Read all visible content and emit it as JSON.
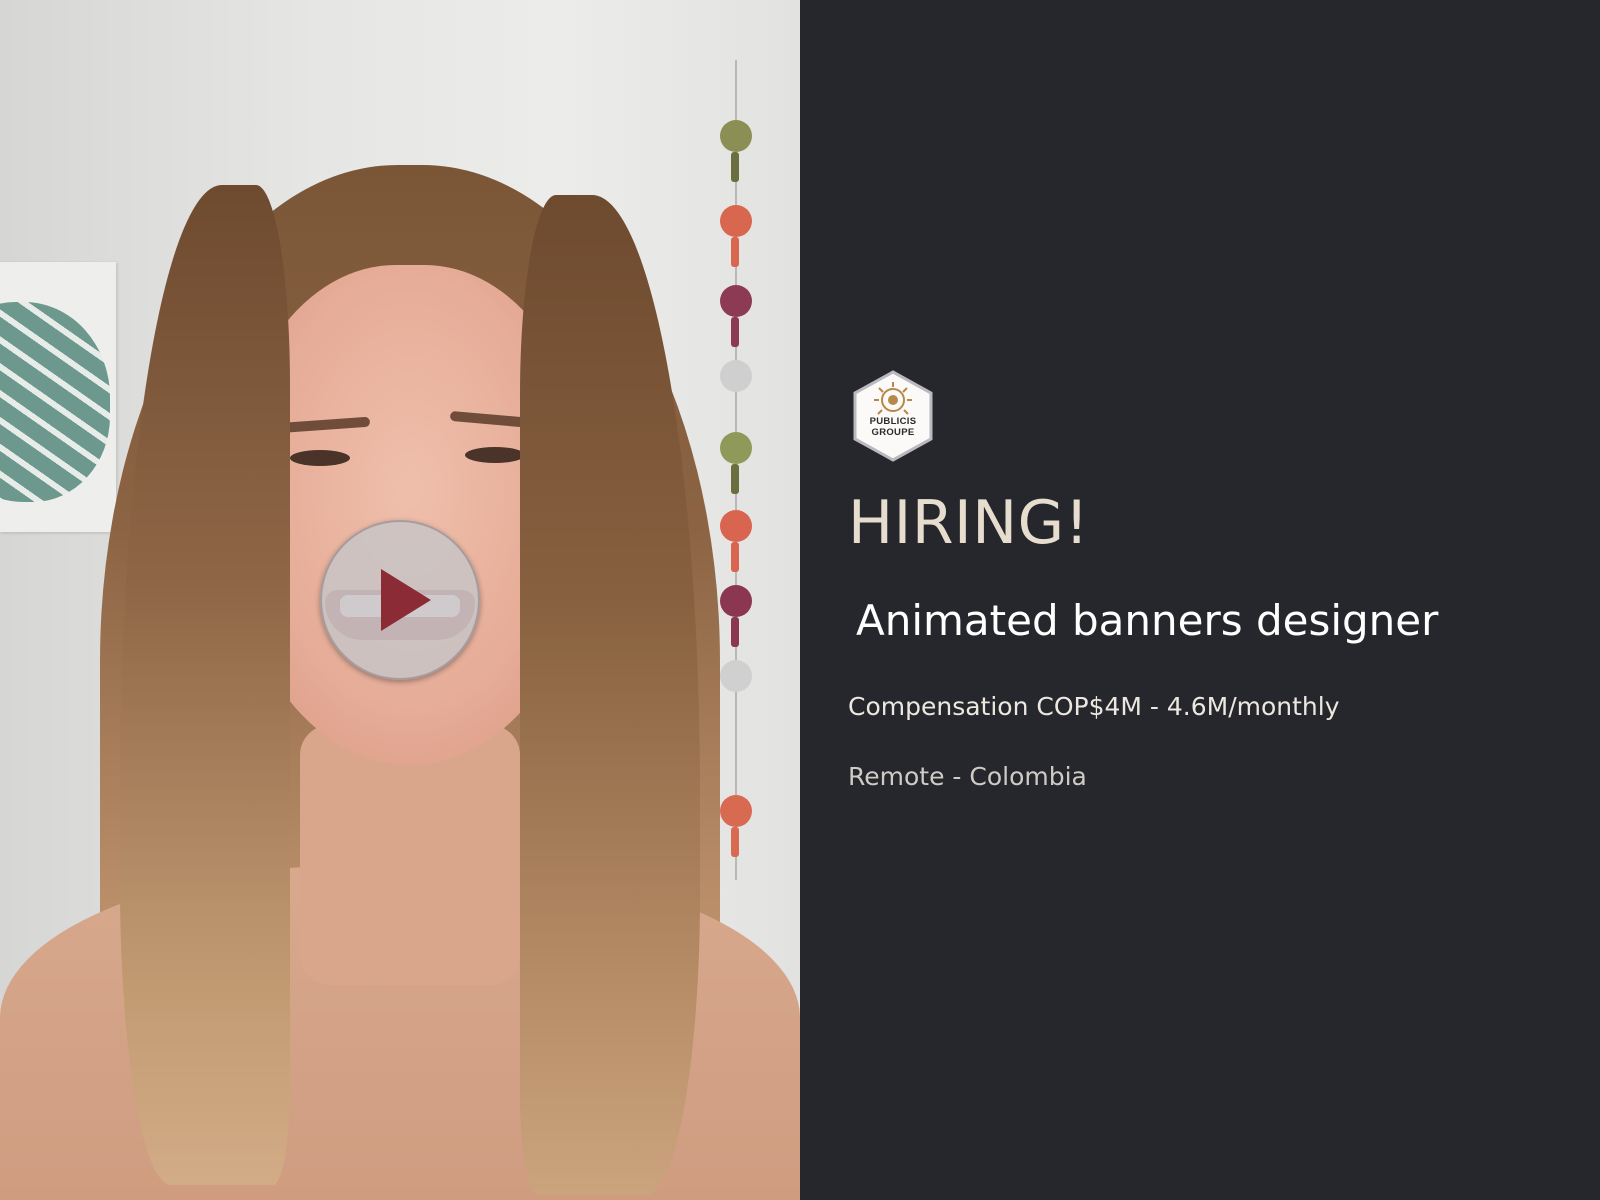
{
  "video": {
    "play_icon": "play-icon",
    "play_button_color": "#c8c4c6",
    "play_triangle_color": "#8a2b35"
  },
  "brand": {
    "logo_line1": "PUBLICIS",
    "logo_line2": "GROUPE",
    "logo_icon": "sun-lion-emblem-icon",
    "logo_accent": "#b8874a"
  },
  "posting": {
    "headline": "HIRING!",
    "role": "Animated banners designer",
    "compensation": "Compensation COP$4M - 4.6M/monthly",
    "location": "Remote - Colombia"
  },
  "colors": {
    "panel_background": "#26272c",
    "headline": "#e6ddcf",
    "role": "#ffffff",
    "body_text": "#ece8e0"
  }
}
